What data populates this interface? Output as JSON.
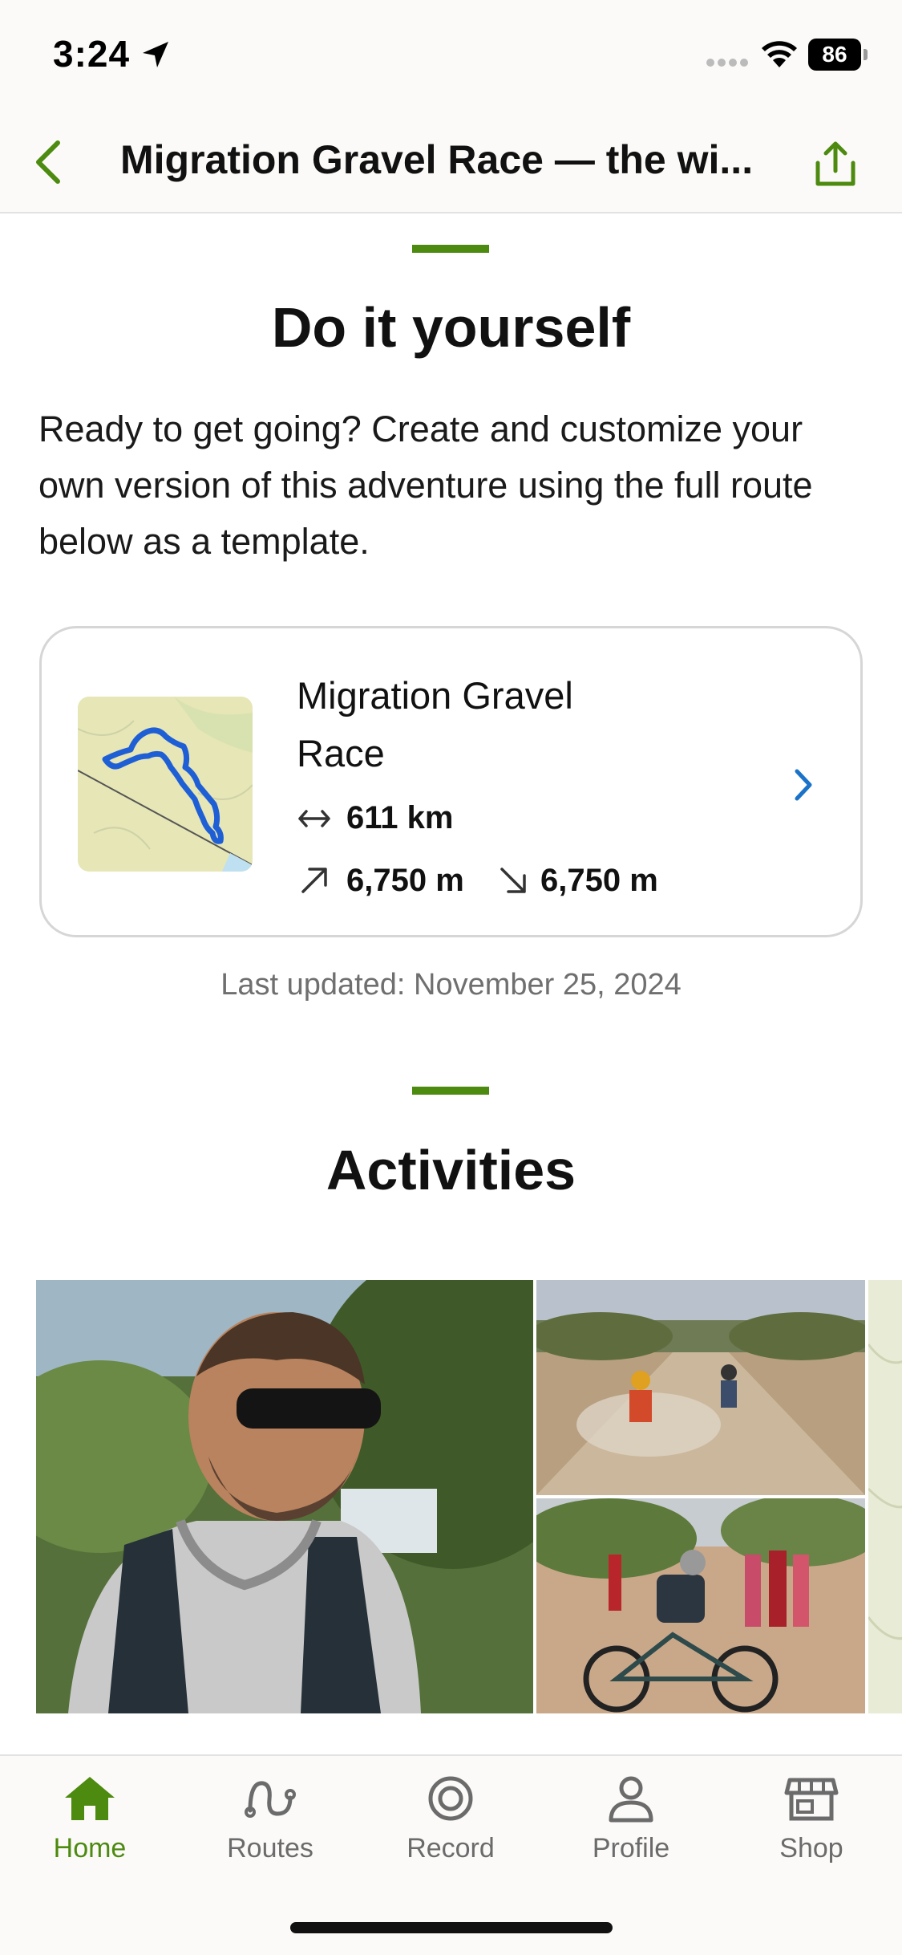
{
  "status": {
    "time": "3:24",
    "battery": "86"
  },
  "header": {
    "title": "Migration Gravel Race — the wi..."
  },
  "diy": {
    "heading": "Do it yourself",
    "intro": "Ready to get going? Create and customize your own version of this adventure using the full route below as a template."
  },
  "route": {
    "name": "Migration Gravel Race",
    "distance": "611 km",
    "ascent": "6,750 m",
    "descent": "6,750 m",
    "last_updated": "Last updated: November 25, 2024"
  },
  "activities": {
    "heading": "Activities"
  },
  "tabs": [
    {
      "label": "Home",
      "icon": "home-icon",
      "active": true
    },
    {
      "label": "Routes",
      "icon": "routes-icon",
      "active": false
    },
    {
      "label": "Record",
      "icon": "record-icon",
      "active": false
    },
    {
      "label": "Profile",
      "icon": "profile-icon",
      "active": false
    },
    {
      "label": "Shop",
      "icon": "shop-icon",
      "active": false
    }
  ],
  "colors": {
    "accent": "#4d8a10",
    "link": "#1a73c8",
    "text": "#111111",
    "muted": "#6f6f6f"
  }
}
